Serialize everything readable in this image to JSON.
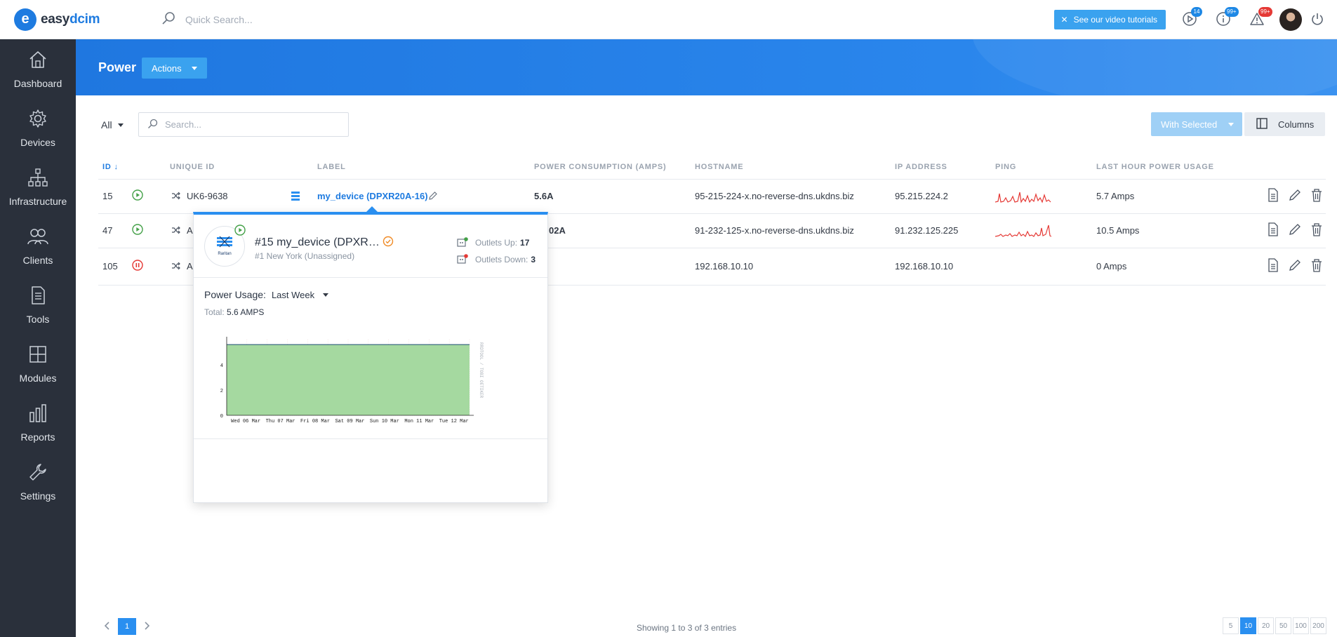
{
  "app": {
    "logo_mark": "e",
    "logo_text_a": "easy",
    "logo_text_b": "dcim"
  },
  "topbar": {
    "search_placeholder": "Quick Search...",
    "tutorials_label": "See our video tutorials",
    "badges": {
      "play": "14",
      "info": "99+",
      "alerts": "99+"
    }
  },
  "sidebar": {
    "items": [
      {
        "label": "Dashboard",
        "icon": "home-icon"
      },
      {
        "label": "Devices",
        "icon": "gear-icon"
      },
      {
        "label": "Infrastructure",
        "icon": "sitemap-icon"
      },
      {
        "label": "Clients",
        "icon": "users-icon"
      },
      {
        "label": "Tools",
        "icon": "document-icon"
      },
      {
        "label": "Modules",
        "icon": "grid-icon"
      },
      {
        "label": "Reports",
        "icon": "bar-chart-icon"
      },
      {
        "label": "Settings",
        "icon": "wrench-icon"
      }
    ]
  },
  "page": {
    "title": "Power",
    "actions_label": "Actions"
  },
  "filters": {
    "scope": "All",
    "search_placeholder": "Search...",
    "with_selected": "With Selected",
    "columns": "Columns"
  },
  "table": {
    "headers": {
      "id": "ID",
      "unique_id": "UNIQUE ID",
      "label": "LABEL",
      "power": "POWER CONSUMPTION (AMPS)",
      "hostname": "HOSTNAME",
      "ip": "IP ADDRESS",
      "ping": "PING",
      "last_hour": "LAST HOUR POWER USAGE"
    },
    "rows": [
      {
        "id": "15",
        "unique_id": "UK6-9638",
        "label": "my_device (DPXR20A-16)",
        "power": "5.6A",
        "hostname": "95-215-224-x.no-reverse-dns.ukdns.biz",
        "ip": "95.215.224.2",
        "last_hour": "5.7 Amps",
        "status": "up"
      },
      {
        "id": "47",
        "unique_id": "A",
        "label": "",
        "power": "02A",
        "hostname": "91-232-125-x.no-reverse-dns.ukdns.biz",
        "ip": "91.232.125.225",
        "last_hour": "10.5 Amps",
        "status": "up"
      },
      {
        "id": "105",
        "unique_id": "A",
        "label": "",
        "power": "",
        "hostname": "192.168.10.10",
        "ip": "192.168.10.10",
        "last_hour": "0 Amps",
        "status": "paused"
      }
    ]
  },
  "popover": {
    "title": "#15 my_device (DPXR…",
    "location": "#1 New York (Unassigned)",
    "outlets_up_label": "Outlets Up:",
    "outlets_up": "17",
    "outlets_down_label": "Outlets Down:",
    "outlets_down": "3",
    "power_usage_label": "Power Usage:",
    "period": "Last Week",
    "total_label": "Total:",
    "total_value": "5.6 AMPS",
    "device_brand": "Raritan"
  },
  "chart_data": {
    "type": "area",
    "x": [
      "Wed 06 Mar",
      "Thu 07 Mar",
      "Fri 08 Mar",
      "Sat 09 Mar",
      "Sun 10 Mar",
      "Mon 11 Mar",
      "Tue 12 Mar"
    ],
    "yticks": [
      "0",
      "2",
      "4"
    ],
    "ylim": [
      0,
      6
    ],
    "values": [
      5.6,
      5.6,
      5.6,
      5.6,
      5.6,
      5.6,
      5.6
    ],
    "side_label": "RRDTOOL / TOBI OETIKER",
    "fill_color": "#a5d9a0",
    "line_color": "#2f5f7a"
  },
  "pagination": {
    "current": "1",
    "showing": "Showing 1 to 3 of 3 entries",
    "sizes": [
      "5",
      "10",
      "20",
      "50",
      "100",
      "200"
    ],
    "active_size": "10"
  },
  "colors": {
    "primary": "#1e7be0",
    "sidebar": "#2a303b",
    "up": "#43a047",
    "paused": "#e53935"
  }
}
